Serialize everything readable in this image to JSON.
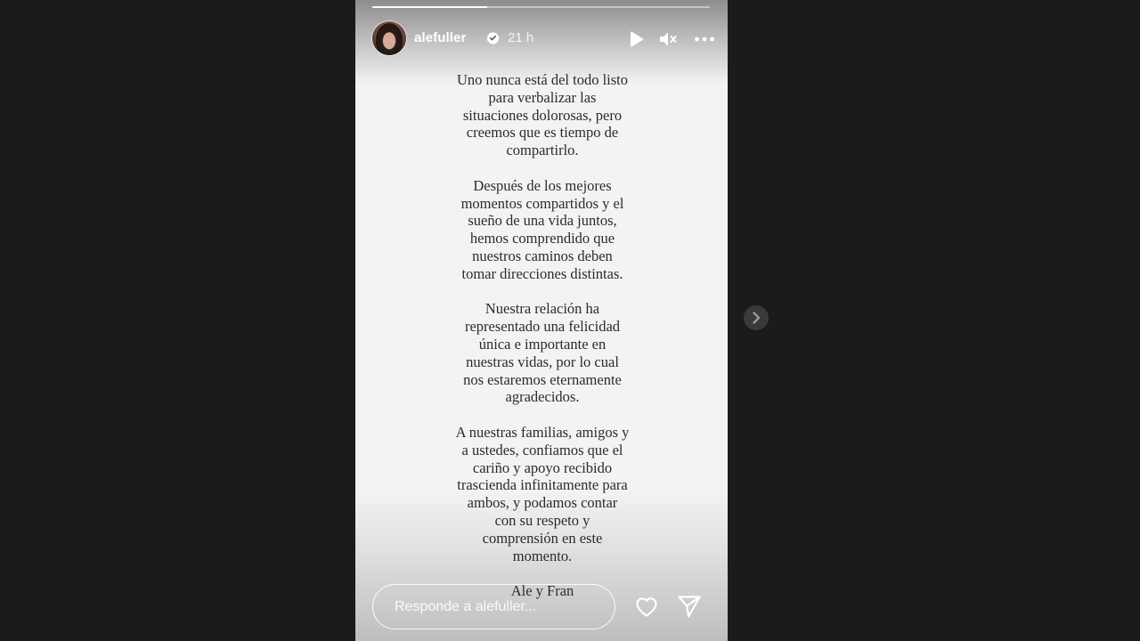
{
  "story": {
    "progress_fraction": 0.34,
    "username": "alefuller",
    "verified": true,
    "time_ago": "21 h",
    "controls": {
      "play_icon": "play-icon",
      "mute_icon": "mute-icon",
      "more_icon": "more-icon"
    },
    "paragraphs": [
      "Uno nunca está del todo listo\npara verbalizar las\nsituaciones dolorosas, pero\ncreemos que es tiempo de\ncompartirlo.",
      "Después de los mejores\nmomentos compartidos y el\nsueño de una vida juntos,\nhemos comprendido que\nnuestros caminos deben\ntomar direcciones distintas.",
      "Nuestra relación ha\nrepresentado una felicidad\núnica e importante en\nnuestras vidas, por lo cual\nnos estaremos eternamente\nagradecidos.",
      "A nuestras familias, amigos y\na ustedes, confiamos que el\ncariño y apoyo recibido\ntrascienda infinitamente para\nambos, y podamos contar\ncon su respeto y\ncomprensión en este\nmomento.",
      "Ale y Fran"
    ],
    "reply": {
      "placeholder": "Responde a alefuller...",
      "value": ""
    },
    "actions": {
      "like_icon": "heart-icon",
      "share_icon": "send-icon"
    }
  },
  "navigation": {
    "next_icon": "chevron-right-icon"
  },
  "colors": {
    "page_background": "#1b1b1b",
    "story_background": "#f3f3f3",
    "letter_text": "#2b2b2b",
    "overlay_text": "#ffffff"
  }
}
